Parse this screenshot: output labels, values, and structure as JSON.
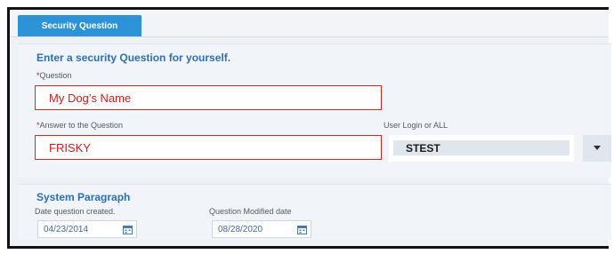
{
  "tab": {
    "label": "Security Question"
  },
  "question_section": {
    "title": "Enter a security Question for yourself.",
    "required_mark": "*",
    "question_label": "Question",
    "question_value": "My Dog’s Name",
    "answer_label": "Answer to the Question",
    "answer_value": "FRISKY",
    "user_login_label": "User Login or ALL",
    "user_login_value": "STEST"
  },
  "system_section": {
    "title": "System Paragraph",
    "created_label": "Date question created.",
    "created_value": "04/23/2014",
    "modified_label": "Question Modified date",
    "modified_value": "08/28/2020"
  },
  "colors": {
    "tab_active": "#2b93d6",
    "section_title": "#2c6fb3",
    "highlight_border": "#e0231f",
    "highlight_text": "#d41b1b"
  },
  "icons": {
    "dropdown": "chevron-down-icon",
    "calendar": "calendar-icon"
  }
}
